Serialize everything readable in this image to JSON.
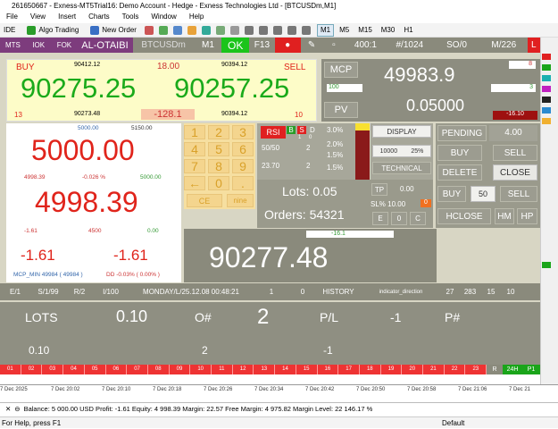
{
  "window": {
    "title": "261650667 - Exness-MT5Trial16: Demo Account - Hedge - Exness Technologies Ltd - [BTCUSDm,M1]"
  },
  "menu": [
    "File",
    "View",
    "Insert",
    "Charts",
    "Tools",
    "Window",
    "Help"
  ],
  "toolbar": {
    "ide": "IDE",
    "algo": "Algo Trading",
    "neworder": "New Order",
    "timeframes": [
      "M1",
      "M5",
      "M15",
      "M30",
      "H1"
    ]
  },
  "ea_bar": {
    "mts": "MTS",
    "iok": "IOK",
    "fok": "FOK",
    "user": "AL-OTAIBI",
    "symbol": "BTCUSDm",
    "tf": "M1",
    "ok": "OK",
    "f13": "F13",
    "r1": "400:1",
    "r2": "#/1024",
    "r3": "SO/0",
    "r4": "M/226",
    "l": "L"
  },
  "quote": {
    "buy_label": "BUY",
    "sell_label": "SELL",
    "buy_high": "90412.12",
    "sell_high": "90394.12",
    "spread": "18.00",
    "buy": "90275.25",
    "sell": "90257.25",
    "buy_low": "90273.48",
    "sell_low": "90394.12",
    "diff": "-128.1",
    "left_n": "13",
    "right_n": "10"
  },
  "mcp": {
    "label": "MCP",
    "value": "49983.9",
    "badge": "8",
    "small_left": "100",
    "small_right": "3",
    "pv_label": "PV",
    "pv": "0.05000",
    "pv_neg": "-16.10"
  },
  "balance": {
    "top1": "5000.00",
    "top2": "5150.00",
    "value": "5000.00",
    "mid1": "4998.39",
    "mid2": "-0.026 %",
    "mid3": "5000.00",
    "equity": "4998.39",
    "r1": "-1.61",
    "r2": "4500",
    "r3": "0.00",
    "pl_left": "-1.61",
    "pl_right": "-1.61",
    "mcp_min": "MCP_MIN 49984 ( 49984 )",
    "dd": "DD -0.03% ( 0.00% )"
  },
  "keypad": {
    "keys": [
      "1",
      "2",
      "3",
      "4",
      "5",
      "6",
      "7",
      "8",
      "9",
      "←",
      "0",
      "."
    ],
    "ce": "CE",
    "nine": "nine"
  },
  "rsi": {
    "rsi": "RSI",
    "b": "B",
    "s": "S",
    "d": "D",
    "r50": "50/50",
    "n2": "2",
    "p3": "3.0%",
    "p2": "2.0%",
    "p15a": "1.5%",
    "v2370": "23.70",
    "p15b": "1.5%",
    "n2b": "2",
    "pct1": "1",
    "pct0": "0"
  },
  "mid": {
    "display": "DISPLAY",
    "tenk": "10000",
    "p25": "25%",
    "technical": "TECHNICAL",
    "tp": "TP",
    "tpv": "0.00",
    "sl": "SL% 10.00",
    "slv": "0"
  },
  "lots": {
    "lots_label": "Lots: 0.05",
    "orders_label": "Orders: 54321",
    "e": "E",
    "zero": "0",
    "c": "C"
  },
  "right": {
    "pending": "PENDING",
    "pend_v": "4.00",
    "buy": "BUY",
    "sell": "SELL",
    "delete": "DELETE",
    "close": "CLOSE",
    "buy2": "BUY",
    "fifty": "50",
    "sell2": "SELL",
    "hclose": "HCLOSE",
    "hm": "HM",
    "hp": "HP"
  },
  "bigprice": {
    "value": "90277.48",
    "tag": "-16.1"
  },
  "info": {
    "e1": "E/1",
    "s1": "S/1/99",
    "r2": "R/2",
    "i100": "I/100",
    "date": "MONDAY/L/25.12.08 00:48:21",
    "one": "1",
    "zero": "0",
    "history": "HISTORY",
    "ind": "indicator_direction",
    "n27": "27",
    "n283": "283",
    "n15": "15",
    "n10": "10"
  },
  "trade": {
    "lots": "LOTS",
    "lotsv": "0.10",
    "onum": "O#",
    "onumv": "2",
    "pl": "P/L",
    "plv": "-1",
    "pnum": "P#",
    "lotsv2": "0.10",
    "onumv2": "2",
    "plv2": "-1"
  },
  "ticker": {
    "labels": [
      "01",
      "02",
      "03",
      "04",
      "05",
      "06",
      "07",
      "08",
      "09",
      "10",
      "11",
      "12",
      "13",
      "14",
      "15",
      "16",
      "17",
      "18",
      "19",
      "20",
      "21",
      "22",
      "23"
    ],
    "r": "R",
    "h24": "24H",
    "p1": "P1"
  },
  "axis": [
    "7 Dec 2025",
    "7 Dec 20:02",
    "7 Dec 20:10",
    "7 Dec 20:18",
    "7 Dec 20:26",
    "7 Dec 20:34",
    "7 Dec 20:42",
    "7 Dec 20:50",
    "7 Dec 20:58",
    "7 Dec 21:06",
    "7 Dec 21"
  ],
  "statusbar": {
    "text": "Balance: 5 000.00 USD  Profit: -1.61  Equity: 4 998.39  Margin: 22.57  Free Margin: 4 975.82  Margin Level: 22 146.17 %"
  },
  "statusbar2": {
    "help": "For Help, press F1",
    "profile": "Default"
  }
}
